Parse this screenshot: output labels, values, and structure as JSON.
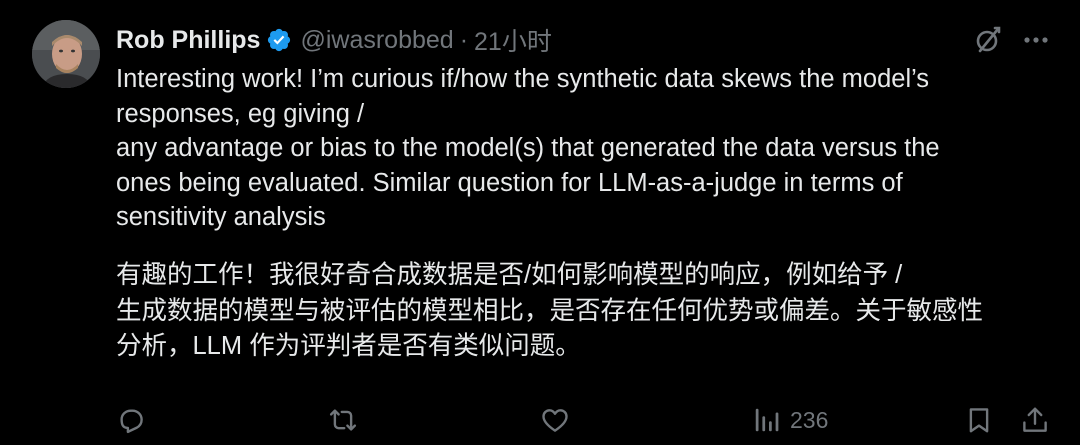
{
  "author": {
    "name": "Rob Phillips",
    "handle": "@iwasrobbed",
    "separator": "·",
    "time": "21小时"
  },
  "body_en": [
    "Interesting work! I’m curious if/how the synthetic data skews the model’s",
    "responses, eg giving /",
    "any advantage or bias to the model(s) that generated the data versus the",
    "ones being evaluated. Similar question for LLM-as-a-judge in terms of",
    "sensitivity analysis"
  ],
  "body_zh": [
    "有趣的工作！我很好奇合成数据是否/如何影响模型的响应，例如给予 /",
    "生成数据的模型与被评估的模型相比，是否存在任何优势或偏差。关于敏感性",
    "分析，LLM 作为评判者是否有类似问题。"
  ],
  "actions": {
    "views_count": "236"
  },
  "icons": {
    "verified": "verified-badge-icon",
    "grok": "grok-icon",
    "more": "more-icon",
    "reply": "reply-icon",
    "repost": "repost-icon",
    "like": "like-icon",
    "views": "views-icon",
    "bookmark": "bookmark-icon",
    "share": "share-icon"
  },
  "colors": {
    "background": "#000000",
    "text": "#e7e9ea",
    "muted": "#71767b",
    "verified": "#1d9bf0"
  }
}
